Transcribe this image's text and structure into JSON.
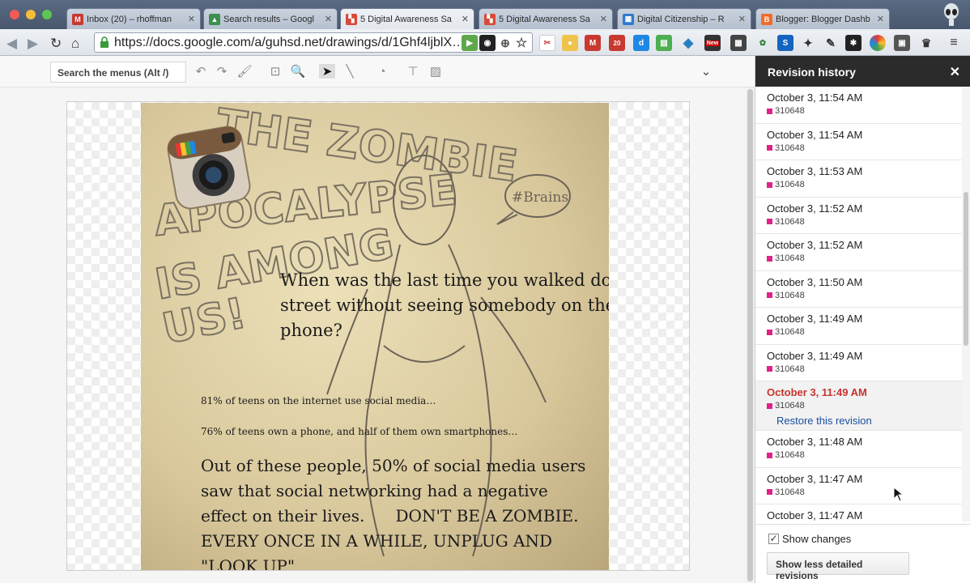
{
  "browser": {
    "tabs": [
      {
        "label": "Inbox (20) – rhoffman",
        "fav_color": "#c8392f",
        "fav_glyph": "M"
      },
      {
        "label": "Search results – Googl",
        "fav_color": "#3b8f4f",
        "fav_glyph": "▲"
      },
      {
        "label": "5 Digital Awareness Sa",
        "fav_color": "#d84a38",
        "fav_glyph": "▚"
      },
      {
        "label": "5 Digital Awareness Sa",
        "fav_color": "#d84a38",
        "fav_glyph": "▚"
      },
      {
        "label": "Digital Citizenship – R",
        "fav_color": "#2f7ad2",
        "fav_glyph": "▦"
      },
      {
        "label": "Blogger: Blogger Dashb",
        "fav_color": "#f26c2a",
        "fav_glyph": "B"
      }
    ],
    "url": "https://docs.google.com/a/guhsd.net/drawings/d/1Ghf4ljblX…",
    "gmail_badge": "20",
    "new_badge": "New"
  },
  "app": {
    "menu_search_label": "Search the menus (Alt /)"
  },
  "slide": {
    "question": "When was the last time you walked down a street without seeing somebody on their phone?",
    "stat1": "81% of teens on the internet use social media…",
    "stat2": "76% of teens own a phone, and half of them own smartphones…",
    "conclusion": "Out of these people, 50% of social media users saw that social networking had a negative effect on their lives.      DON'T BE A ZOMBIE. EVERY ONCE IN A WHILE, UNPLUG AND \"LOOK UP\"",
    "sketch_title": "THE ZOMBIE APOCALYPSE IS AMONG US",
    "speech_bubble": "#Brains"
  },
  "revision_panel": {
    "title": "Revision history",
    "revisions": [
      {
        "when": "October 3, 11:54 AM",
        "who": "310648"
      },
      {
        "when": "October 3, 11:54 AM",
        "who": "310648"
      },
      {
        "when": "October 3, 11:53 AM",
        "who": "310648"
      },
      {
        "when": "October 3, 11:52 AM",
        "who": "310648"
      },
      {
        "when": "October 3, 11:52 AM",
        "who": "310648"
      },
      {
        "when": "October 3, 11:50 AM",
        "who": "310648"
      },
      {
        "when": "October 3, 11:49 AM",
        "who": "310648"
      },
      {
        "when": "October 3, 11:49 AM",
        "who": "310648"
      },
      {
        "when": "October 3, 11:49 AM",
        "who": "310648",
        "selected": true
      },
      {
        "when": "October 3, 11:48 AM",
        "who": "310648"
      },
      {
        "when": "October 3, 11:47 AM",
        "who": "310648"
      },
      {
        "when": "October 3, 11:47 AM",
        "who": ""
      }
    ],
    "restore_label": "Restore this revision",
    "show_changes_label": "Show changes",
    "show_changes_checked": true,
    "less_detail_label": "Show less detailed revisions",
    "author_color": "#e0218a"
  }
}
